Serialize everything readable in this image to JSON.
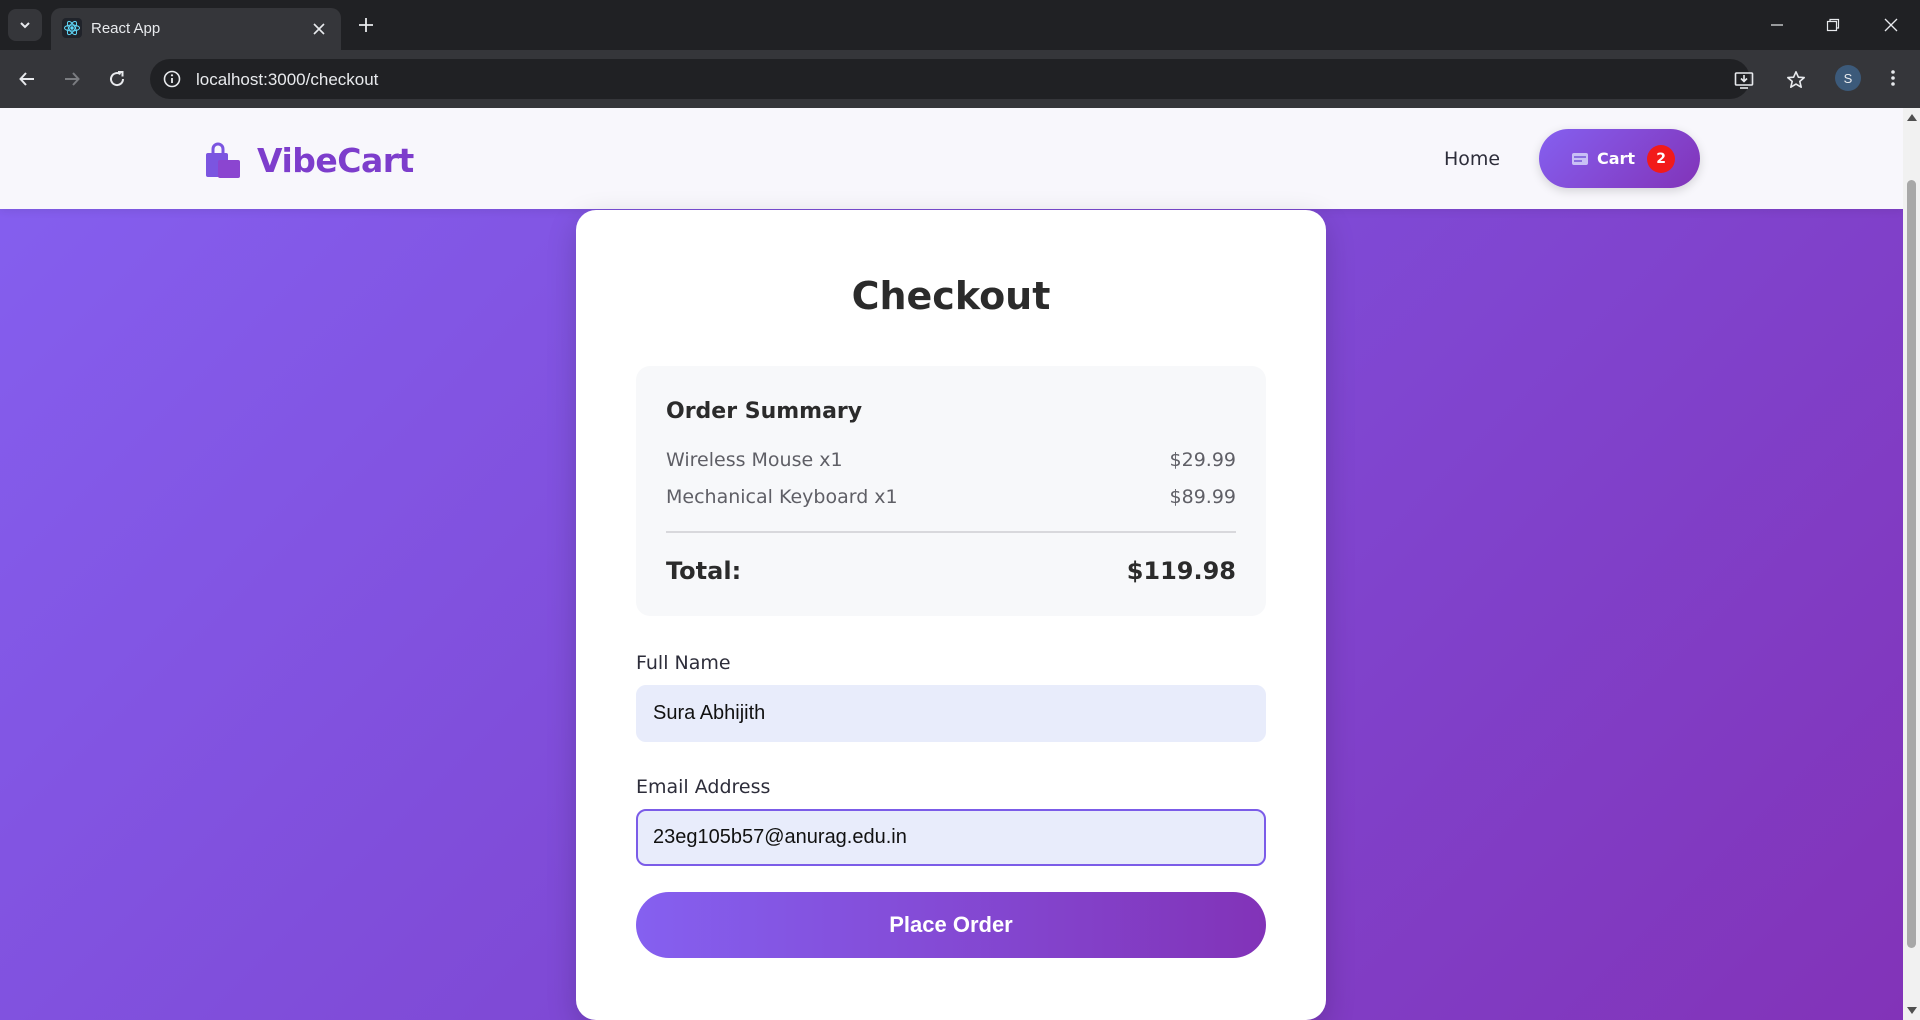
{
  "browser": {
    "tab_title": "React App",
    "url": "localhost:3000/checkout",
    "profile_initial": "S"
  },
  "navbar": {
    "brand": "VibeCart",
    "home_link": "Home",
    "cart_label": "Cart",
    "cart_count": "2"
  },
  "checkout": {
    "title": "Checkout",
    "summary": {
      "heading": "Order Summary",
      "items": [
        {
          "name": "Wireless Mouse x1",
          "price": "$29.99"
        },
        {
          "name": "Mechanical Keyboard x1",
          "price": "$89.99"
        }
      ],
      "total_label": "Total:",
      "total_value": "$119.98"
    },
    "full_name": {
      "label": "Full Name",
      "value": "Sura Abhijith"
    },
    "email": {
      "label": "Email Address",
      "value": "23eg105b57@anurag.edu.in"
    },
    "submit_label": "Place Order"
  },
  "colors": {
    "accent_start": "#8560f0",
    "accent_end": "#8233b8",
    "brand": "#7d3dcc",
    "badge": "#f21a1a"
  }
}
